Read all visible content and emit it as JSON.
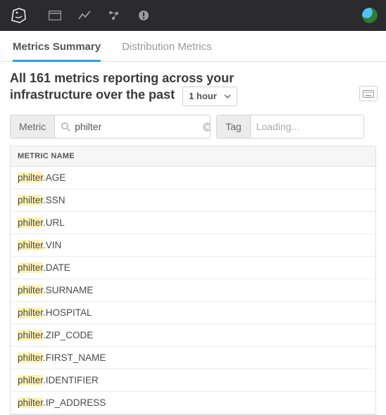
{
  "tabs": {
    "summary": "Metrics Summary",
    "distribution": "Distribution Metrics"
  },
  "heading": {
    "prefix": "All ",
    "count": "161",
    "middle": " metrics reporting across your infrastructure over the past"
  },
  "time_select": {
    "value": "1 hour"
  },
  "filters": {
    "metric_label": "Metric",
    "metric_value": "philter",
    "tag_label": "Tag",
    "tag_placeholder": "Loading..."
  },
  "table": {
    "header": "METRIC NAME",
    "highlight": "philter",
    "rows": [
      ".AGE",
      ".SSN",
      ".URL",
      ".VIN",
      ".DATE",
      ".SURNAME",
      ".HOSPITAL",
      ".ZIP_CODE",
      ".FIRST_NAME",
      ".IDENTIFIER",
      ".IP_ADDRESS"
    ]
  }
}
